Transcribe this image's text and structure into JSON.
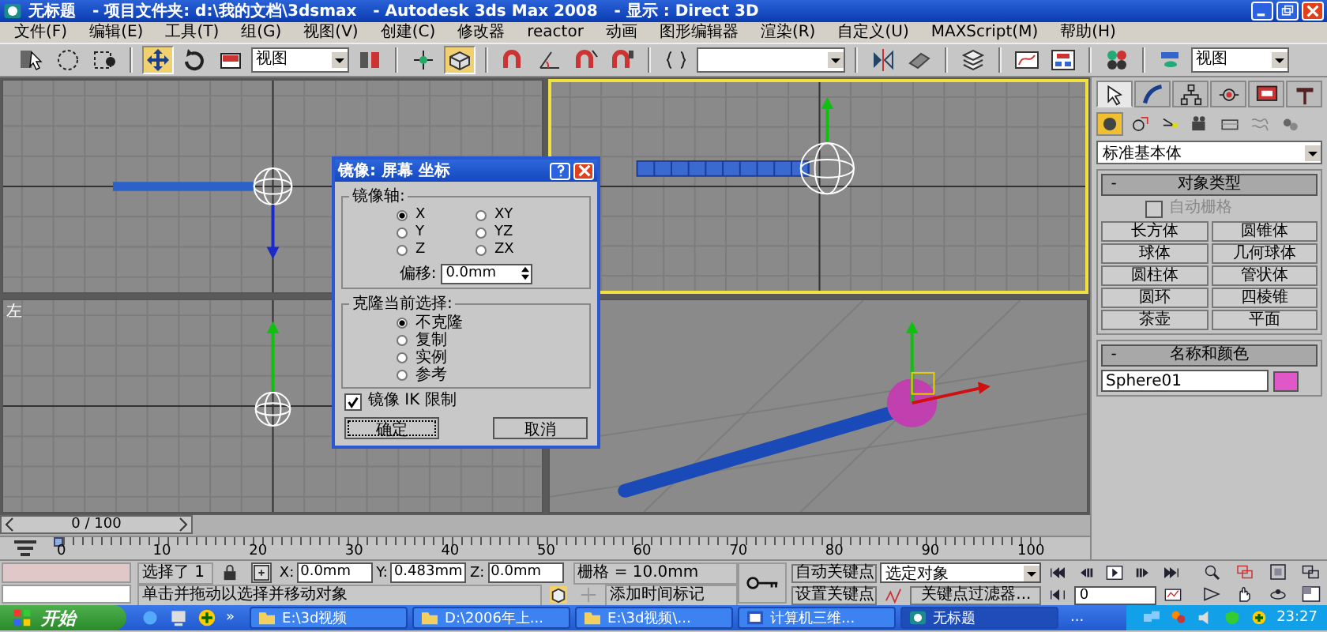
{
  "window": {
    "title": "无标题   - 项目文件夹: d:\\我的文档\\3dsmax   - Autodesk 3ds Max 2008   - 显示 : Direct 3D"
  },
  "menu": [
    "文件(F)",
    "编辑(E)",
    "工具(T)",
    "组(G)",
    "视图(V)",
    "创建(C)",
    "修改器",
    "reactor",
    "动画",
    "图形编辑器",
    "渲染(R)",
    "自定义(U)",
    "MAXScript(M)",
    "帮助(H)"
  ],
  "toolbar": {
    "groups": [
      [
        {
          "kind": "tool",
          "selected": false
        },
        {
          "kind": "tool",
          "selected": false
        },
        {
          "kind": "tool",
          "selected": false
        }
      ],
      [
        {
          "kind": "tool",
          "selected": true
        },
        {
          "kind": "tool",
          "selected": false
        },
        {
          "kind": "tool",
          "selected": false
        },
        {
          "kind": "dropdown",
          "value": "视图"
        },
        {
          "kind": "tool",
          "selected": false
        }
      ],
      [
        {
          "kind": "tool",
          "selected": false
        },
        {
          "kind": "tool",
          "selected": true
        }
      ],
      [
        {
          "kind": "tool",
          "selected": false
        },
        {
          "kind": "tool",
          "selected": false
        },
        {
          "kind": "tool",
          "selected": false
        },
        {
          "kind": "tool",
          "selected": false
        }
      ],
      [
        {
          "kind": "tool",
          "selected": false
        },
        {
          "kind": "dropdown"
        }
      ],
      [
        {
          "kind": "tool",
          "selected": false
        },
        {
          "kind": "tool",
          "selected": false
        }
      ],
      [
        {
          "kind": "tool",
          "selected": false
        }
      ],
      [
        {
          "kind": "tool",
          "selected": false
        },
        {
          "kind": "tool",
          "selected": false
        }
      ],
      [
        {
          "kind": "tool",
          "selected": false
        }
      ],
      [
        {
          "kind": "tool",
          "selected": false
        },
        {
          "kind": "dropdown",
          "value": "视图"
        }
      ]
    ]
  },
  "viewports": [
    {
      "kind": "top",
      "selected": false
    },
    {
      "kind": "front",
      "selected": true
    },
    {
      "kind": "left",
      "selected": false,
      "label": "左"
    },
    {
      "kind": "perspective",
      "selected": false
    }
  ],
  "dialog": {
    "title": "镜像: 屏幕 坐标",
    "axis_group": "镜像轴:",
    "axes": [
      {
        "label": "X",
        "selected": true
      },
      {
        "label": "Y",
        "selected": false
      },
      {
        "label": "Z",
        "selected": false
      },
      {
        "label": "XY",
        "selected": false
      },
      {
        "label": "YZ",
        "selected": false
      },
      {
        "label": "ZX",
        "selected": false
      }
    ],
    "offset_label": "偏移:",
    "offset_value": "0.0mm",
    "clone_group": "克隆当前选择:",
    "clone_options": [
      {
        "label": "不克隆",
        "selected": true
      },
      {
        "label": "复制",
        "selected": false
      },
      {
        "label": "实例",
        "selected": false
      },
      {
        "label": "参考",
        "selected": false
      }
    ],
    "ik_checkbox": {
      "label": "镜像 IK 限制",
      "checked": true
    },
    "buttons": [
      "确定",
      "取消"
    ]
  },
  "command_panel": {
    "tabs": [
      {
        "selected": true
      },
      {
        "selected": false
      },
      {
        "selected": false
      },
      {
        "selected": false
      },
      {
        "selected": false
      },
      {
        "selected": false
      }
    ],
    "categories": [
      {
        "selected": true
      },
      {
        "selected": false
      },
      {
        "selected": false
      },
      {
        "selected": false
      },
      {
        "selected": false
      },
      {
        "selected": false
      },
      {
        "selected": false
      }
    ],
    "dropdown": "标准基本体",
    "object_type": {
      "sign": "-",
      "title": "对象类型",
      "autogrid": {
        "label": "自动栅格",
        "checked": false,
        "disabled": true
      },
      "buttons": [
        "长方体",
        "圆锥体",
        "球体",
        "几何球体",
        "圆柱体",
        "管状体",
        "圆环",
        "四棱锥",
        "茶壶",
        "平面"
      ]
    },
    "name_color": {
      "sign": "-",
      "title": "名称和颜色",
      "name": "Sphere01",
      "color": "#e058c8"
    }
  },
  "time_slider": {
    "text": "0 / 100",
    "level": 0
  },
  "track_bar": {
    "labels": [
      "0",
      "10",
      "20",
      "30",
      "40",
      "50",
      "60",
      "70",
      "80",
      "90",
      "100"
    ]
  },
  "status": {
    "selected": "选择了 1",
    "x_label": "X:",
    "x": "0.0mm",
    "y_label": "Y:",
    "y": "0.483mm",
    "z_label": "Z:",
    "z": "0.0mm",
    "grid": "栅格 = 10.0mm",
    "prompt": "单击并拖动以选择并移动对象",
    "time_tag": "添加时间标记",
    "auto_key": "自动关键点",
    "key_set": "选定对象",
    "set_key": "设置关键点",
    "key_filters": "关键点过滤器...",
    "frame": "0"
  },
  "taskbar": {
    "start": "开始",
    "overflow": "»",
    "tasks": [
      {
        "kind": "folder",
        "label": "E:\\3d视频",
        "selected": false
      },
      {
        "kind": "folder",
        "label": "D:\\2006年上...",
        "selected": false
      },
      {
        "kind": "folder",
        "label": "E:\\3d视频\\...",
        "selected": false
      },
      {
        "kind": "word",
        "label": "计算机三维...",
        "selected": false
      },
      {
        "kind": "app",
        "label": "无标题",
        "selected": true
      },
      {
        "kind": "none",
        "label": "...",
        "selected": false
      }
    ],
    "clock": "23:27"
  }
}
